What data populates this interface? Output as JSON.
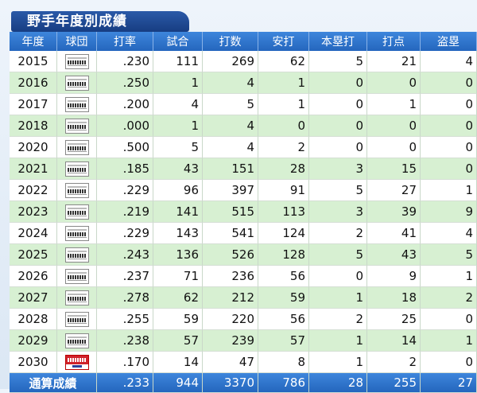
{
  "title": "野手年度別成績",
  "columns": [
    "年度",
    "球団",
    "打率",
    "試合",
    "打数",
    "安打",
    "本塁打",
    "打点",
    "盗塁"
  ],
  "rows": [
    {
      "year": "2015",
      "team": "marines",
      "avg": ".230",
      "g": "111",
      "ab": "269",
      "h": "62",
      "hr": "5",
      "rbi": "21",
      "sb": "4"
    },
    {
      "year": "2016",
      "team": "marines",
      "avg": ".250",
      "g": "1",
      "ab": "4",
      "h": "1",
      "hr": "0",
      "rbi": "0",
      "sb": "0"
    },
    {
      "year": "2017",
      "team": "marines",
      "avg": ".200",
      "g": "4",
      "ab": "5",
      "h": "1",
      "hr": "0",
      "rbi": "1",
      "sb": "0"
    },
    {
      "year": "2018",
      "team": "marines",
      "avg": ".000",
      "g": "1",
      "ab": "4",
      "h": "0",
      "hr": "0",
      "rbi": "0",
      "sb": "0"
    },
    {
      "year": "2020",
      "team": "marines",
      "avg": ".500",
      "g": "5",
      "ab": "4",
      "h": "2",
      "hr": "0",
      "rbi": "0",
      "sb": "0"
    },
    {
      "year": "2021",
      "team": "marines",
      "avg": ".185",
      "g": "43",
      "ab": "151",
      "h": "28",
      "hr": "3",
      "rbi": "15",
      "sb": "0"
    },
    {
      "year": "2022",
      "team": "marines",
      "avg": ".229",
      "g": "96",
      "ab": "397",
      "h": "91",
      "hr": "5",
      "rbi": "27",
      "sb": "1"
    },
    {
      "year": "2023",
      "team": "marines",
      "avg": ".219",
      "g": "141",
      "ab": "515",
      "h": "113",
      "hr": "3",
      "rbi": "39",
      "sb": "9"
    },
    {
      "year": "2024",
      "team": "marines",
      "avg": ".229",
      "g": "143",
      "ab": "541",
      "h": "124",
      "hr": "2",
      "rbi": "41",
      "sb": "4"
    },
    {
      "year": "2025",
      "team": "marines",
      "avg": ".243",
      "g": "136",
      "ab": "526",
      "h": "128",
      "hr": "5",
      "rbi": "43",
      "sb": "5"
    },
    {
      "year": "2026",
      "team": "marines",
      "avg": ".237",
      "g": "71",
      "ab": "236",
      "h": "56",
      "hr": "0",
      "rbi": "9",
      "sb": "1"
    },
    {
      "year": "2027",
      "team": "marines",
      "avg": ".278",
      "g": "62",
      "ab": "212",
      "h": "59",
      "hr": "1",
      "rbi": "18",
      "sb": "2"
    },
    {
      "year": "2028",
      "team": "marines",
      "avg": ".255",
      "g": "59",
      "ab": "220",
      "h": "56",
      "hr": "2",
      "rbi": "25",
      "sb": "0"
    },
    {
      "year": "2029",
      "team": "marines",
      "avg": ".238",
      "g": "57",
      "ab": "239",
      "h": "57",
      "hr": "1",
      "rbi": "14",
      "sb": "1"
    },
    {
      "year": "2030",
      "team": "dragons",
      "avg": ".170",
      "g": "14",
      "ab": "47",
      "h": "8",
      "hr": "1",
      "rbi": "2",
      "sb": "0"
    }
  ],
  "total": {
    "label": "通算成績",
    "avg": ".233",
    "g": "944",
    "ab": "3370",
    "h": "786",
    "hr": "28",
    "rbi": "255",
    "sb": "27"
  },
  "colors": {
    "header": "#2466bd",
    "row_alt": "#d7f0d2",
    "title": "#173d82"
  },
  "icons": {
    "marines": "marines-logo-icon",
    "dragons": "dragons-logo-icon"
  }
}
